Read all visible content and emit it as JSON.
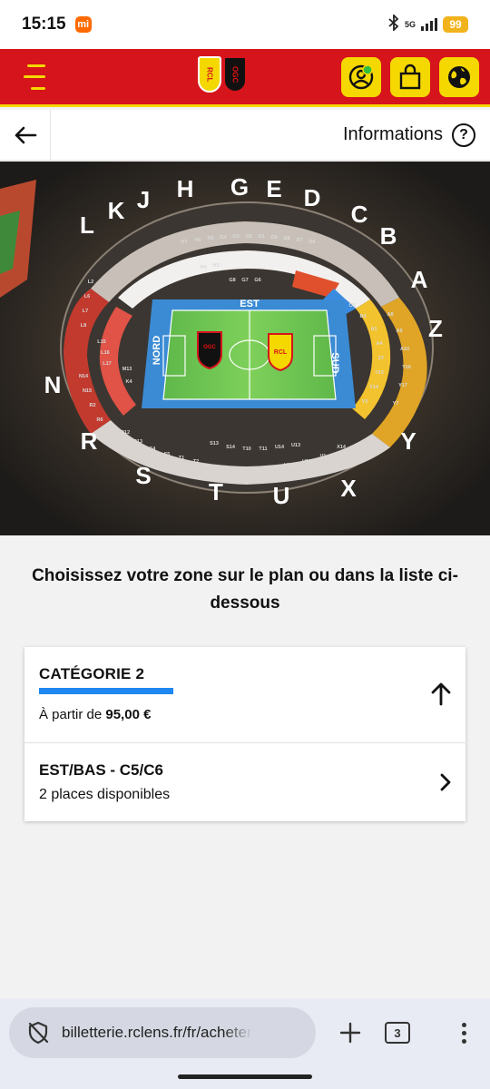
{
  "status": {
    "time": "15:15",
    "mi": "mi",
    "network": "5G",
    "battery": "99"
  },
  "header": {
    "logo_rcl": "RCL",
    "logo_ogc": "OGC",
    "icons": [
      "menu-icon",
      "account-icon",
      "bag-icon",
      "globe-icon"
    ]
  },
  "nav": {
    "back_icon": "arrow-left-icon",
    "info_label": "Informations",
    "help_glyph": "?"
  },
  "stadium": {
    "stands": {
      "north": "NORD",
      "east": "EST",
      "south": "SUD"
    },
    "pitch_logos": [
      "OGC NICE",
      "RCL"
    ],
    "blocks_top": [
      "L",
      "K",
      "J",
      "H",
      "G",
      "E",
      "D",
      "C",
      "B"
    ],
    "blocks_right": [
      "A",
      "Z"
    ],
    "blocks_left": [
      "N"
    ],
    "blocks_bottom": [
      "R",
      "S",
      "T",
      "U",
      "X",
      "Y"
    ]
  },
  "main": {
    "prompt": "Choisissez votre zone sur le plan ou dans la liste ci-dessous",
    "category": {
      "title": "CATÉGORIE 2",
      "price_prefix": "À partir de",
      "price": "95,00 €",
      "color": "#1e88f0"
    },
    "zone": {
      "title": "EST/BAS - C5/C6",
      "availability": "2 places disponibles"
    }
  },
  "browser": {
    "url": "billetterie.rclens.fr/fr/acheter",
    "tab_count": "3"
  },
  "colors": {
    "brand_red": "#d6141b",
    "brand_yellow": "#f5d800",
    "accent_blue": "#1e88f0"
  }
}
